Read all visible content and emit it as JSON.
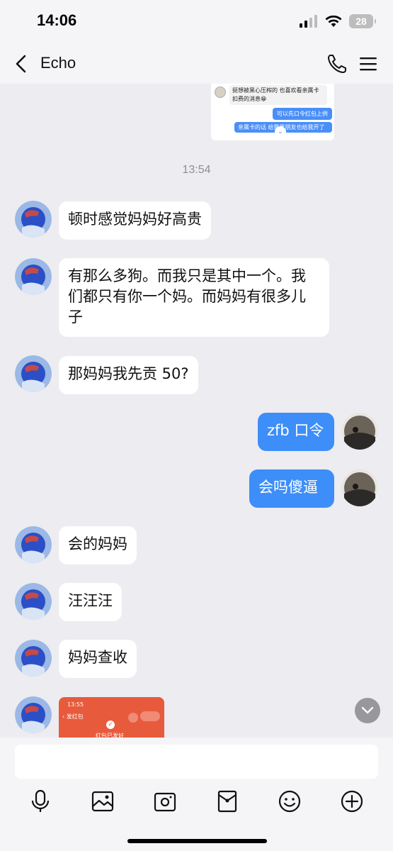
{
  "status_bar": {
    "time": "14:06",
    "battery": "28"
  },
  "header": {
    "title": "Echo"
  },
  "quoted_card": {
    "line1": "挺想被黑心压榨的 也喜欢看亲属卡扣费的消息😁",
    "line2": "可以先口令红包上供",
    "line3": "亲属卡的话 给我男朋友也给我开了"
  },
  "timestamp": "13:54",
  "messages": [
    {
      "side": "left",
      "text": "顿时感觉妈妈好高贵"
    },
    {
      "side": "left",
      "text": "有那么多狗。而我只是其中一个。我们都只有你一个妈。而妈妈有很多儿子"
    },
    {
      "side": "left",
      "text": "那妈妈我先贡 50?"
    },
    {
      "side": "right",
      "text": "zfb 口令"
    },
    {
      "side": "right",
      "text": "会吗傻逼"
    },
    {
      "side": "left",
      "text": "会的妈妈"
    },
    {
      "side": "left",
      "text": "汪汪汪"
    },
    {
      "side": "left",
      "text": "妈妈查收"
    }
  ],
  "image_message": {
    "time": "13:55",
    "back_label": "发红包",
    "status_text": "红包已发好"
  },
  "composer": {
    "placeholder": ""
  },
  "colors": {
    "accent": "#3d8ef8",
    "background": "#ececf1",
    "bubble_left": "#ffffff"
  }
}
